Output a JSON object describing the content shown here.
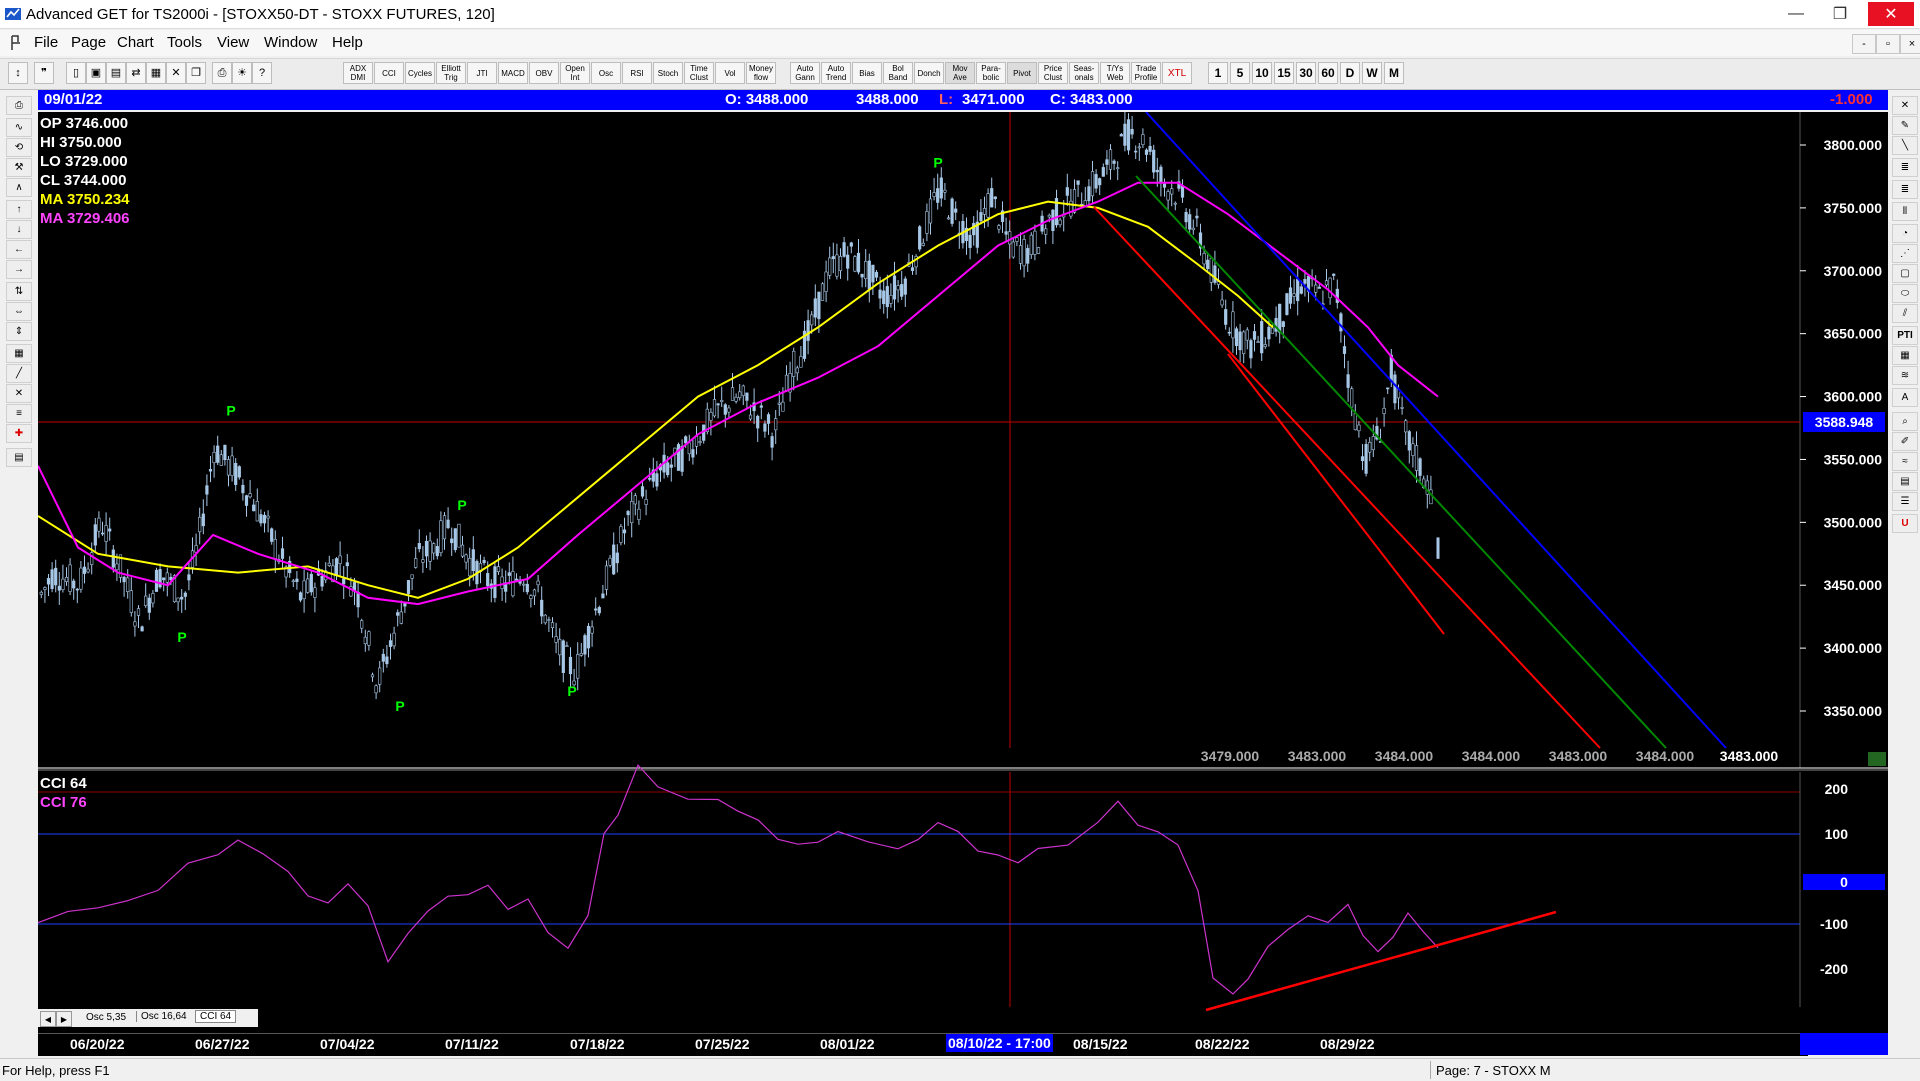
{
  "window": {
    "title": "Advanced GET for TS2000i - [STOXX50-DT - STOXX FUTURES, 120]",
    "minimize": "—",
    "restore": "❐",
    "close": "✕"
  },
  "menubar": {
    "items": [
      "File",
      "Page",
      "Chart",
      "Tools",
      "View",
      "Window",
      "Help"
    ],
    "mdi_controls": [
      "-",
      "▫",
      "×"
    ]
  },
  "toolbar": {
    "indicators": [
      "ADX DMI",
      "CCI",
      "Cycles",
      "Elliott Trig",
      "JTI",
      "MACD",
      "OBV",
      "Open Int",
      "Osc",
      "RSI",
      "Stoch",
      "Time Clust",
      "Vol",
      "Money flow",
      "Auto Gann",
      "Auto Trend",
      "Bias",
      "Bol Band",
      "Donch",
      "Mov Ave",
      "Para-bolic",
      "Pivot",
      "Price Clust",
      "Seas-onals",
      "T/Ys Web",
      "Trade Profile",
      "XTL"
    ],
    "periods": [
      "1",
      "5",
      "10",
      "15",
      "30",
      "60",
      "D",
      "W",
      "M"
    ]
  },
  "infobar": {
    "date": "09/01/22",
    "open": "O: 3488.000",
    "high": "3488.000",
    "low_label": "L:",
    "low": "3471.000",
    "close": "C: 3483.000",
    "change": "-1.000"
  },
  "ohlc_panel": {
    "op": "OP  3746.000",
    "hi": "HI   3750.000",
    "lo": "LO  3729.000",
    "cl": "CL  3744.000",
    "ma1": "MA  3750.234",
    "ma2": "MA  3729.406"
  },
  "price_axis": {
    "labels": [
      "3800.000",
      "3750.000",
      "3700.000",
      "3650.000",
      "3600.000",
      "3550.000",
      "3500.000",
      "3450.000",
      "3400.000",
      "3350.000"
    ],
    "current_price": "3588.948"
  },
  "projection_labels": [
    "3479.000",
    "3483.000",
    "3484.000",
    "3484.000",
    "3483.000",
    "3484.000"
  ],
  "last_price": "3483.000",
  "pivot_label": "P",
  "oscillator": {
    "title": "CCI 64",
    "value_label": "CCI  76",
    "axis_labels": [
      "200",
      "100",
      "-100",
      "-200"
    ],
    "zero_label": "0",
    "tabs": [
      "Osc 5,35",
      "Osc 16,64",
      "CCI 64"
    ]
  },
  "date_axis": {
    "labels": [
      "06/20/22",
      "06/27/22",
      "07/04/22",
      "07/11/22",
      "07/18/22",
      "07/25/22",
      "08/01/22",
      "08/15/22",
      "08/22/22",
      "08/29/22"
    ],
    "cursor_date": "08/10/22 - 17:00"
  },
  "statusbar": {
    "help": "For Help, press F1",
    "page": "Page: 7 - STOXX M"
  },
  "colors": {
    "background": "#000000",
    "candles": "#a7c7e7",
    "ma_fast": "#ffff00",
    "ma_slow": "#ff00ff",
    "channel_red": "#ff0000",
    "channel_green": "#009900",
    "channel_blue": "#0000ff",
    "pivot_green": "#00ff00",
    "infobar": "#0000ff"
  }
}
